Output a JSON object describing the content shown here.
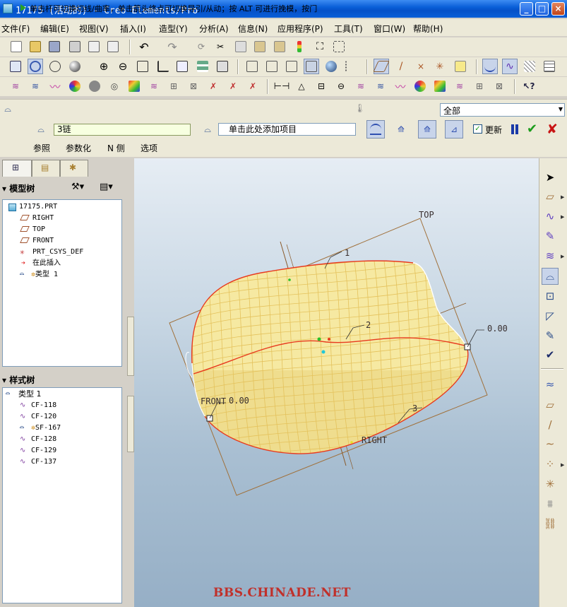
{
  "window": {
    "title": "17175 (活动的) - Creo Elements/Pro",
    "min_label": "_",
    "max_label": "□",
    "close_label": "×"
  },
  "menu": [
    "文件(F)",
    "编辑(E)",
    "视图(V)",
    "插入(I)",
    "造型(Y)",
    "分析(A)",
    "信息(N)",
    "应用程序(P)",
    "工具(T)",
    "窗口(W)",
    "帮助(H)"
  ],
  "toolbar_icons": {
    "row1": [
      "new-icon",
      "open-icon",
      "save-icon",
      "print-icon",
      "email-icon",
      "email-link-icon",
      "undo-icon",
      "redo-icon",
      "regenerate-icon",
      "cut-icon",
      "copy-icon",
      "paste-icon",
      "paste-special-icon",
      "traffic-light-icon",
      "find-icon",
      "select-box-icon"
    ],
    "row2": [
      "repaint-icon",
      "spin-center-icon",
      "orient-mode-icon",
      "appearance-icon",
      "zoom-in-icon",
      "zoom-out-icon",
      "refit-icon",
      "reorient-icon",
      "saved-views-icon",
      "layers-icon",
      "view-manager-icon",
      "wireframe-icon",
      "hidden-line-icon",
      "no-hidden-icon",
      "shading-icon",
      "enhanced-realism-icon",
      "model-tree-display-icon",
      "datum-plane-display-icon",
      "datum-axis-display-icon",
      "datum-point-display-icon",
      "csys-display-icon",
      "style-display-icon",
      "curve-display-icon",
      "surface-grid-icon",
      "grid-icon"
    ],
    "row3": [
      "curvature-icon",
      "section-icon",
      "offset-icon",
      "reflection-icon",
      "shade-curvature-icon",
      "draft-icon",
      "slope-icon",
      "dihedral-icon",
      "surface-node-icon",
      "deviation-icon",
      "delete-curvature-icon",
      "delete-section-icon",
      "delete-all-icon",
      "delete-analysis-icon",
      "measure-icon",
      "dimension-icon",
      "table-icon",
      "lock-icon",
      "curve-analysis-icon",
      "surface-analysis-icon",
      "connect-icon",
      "color-analysis-icon",
      "draft-analysis-icon",
      "graph-icon",
      "node-icon",
      "compare-icon",
      "context-help-icon"
    ]
  },
  "dashboard": {
    "prompt": "单击杆可切换切线/曲率，单击箭头终点可切换导引/从动；按 ALT 可进行挽模，按门",
    "filter": "全部",
    "chain_value": "3链",
    "add_item_placeholder": "单击此处添加项目",
    "update_label": "更新",
    "update_checked": true,
    "tabs": [
      "参照",
      "参数化",
      "N 侧",
      "选项"
    ]
  },
  "model_tree": {
    "header": "模型树",
    "items": [
      {
        "label": "17175.PRT",
        "icon": "part-icon"
      },
      {
        "label": "RIGHT",
        "icon": "datum-plane-icon"
      },
      {
        "label": "TOP",
        "icon": "datum-plane-icon"
      },
      {
        "label": "FRONT",
        "icon": "datum-plane-icon"
      },
      {
        "label": "PRT_CSYS_DEF",
        "icon": "csys-icon"
      },
      {
        "label": "在此插入",
        "icon": "insert-here-icon"
      },
      {
        "label": "类型 1",
        "icon": "style-feature-icon"
      }
    ]
  },
  "style_tree": {
    "header": "样式树",
    "items": [
      {
        "label": "类型 1",
        "icon": "style-feature-icon"
      },
      {
        "label": "CF-118",
        "icon": "curve-icon"
      },
      {
        "label": "CF-120",
        "icon": "curve-icon"
      },
      {
        "label": "SF-167",
        "icon": "surface-icon"
      },
      {
        "label": "CF-128",
        "icon": "curve-icon"
      },
      {
        "label": "CF-129",
        "icon": "curve-icon"
      },
      {
        "label": "CF-137",
        "icon": "curve-icon"
      }
    ]
  },
  "graphics": {
    "plane_labels": {
      "top": "TOP",
      "front": "FRONT",
      "right": "RIGHT"
    },
    "curve_labels": [
      "1",
      "2",
      "3"
    ],
    "tangent_values": {
      "left": "0.00",
      "right": "0.00"
    },
    "watermark": "BBS.CHINADE.NET",
    "colors": {
      "surface": "#f6e9a2",
      "grid": "#e4c25c",
      "boundary": "#e83a1e",
      "plane": "#a0703a",
      "background": "#a9bfd2"
    }
  },
  "right_toolbar": [
    "select-arrow-icon",
    "set-active-plane-icon",
    "create-curve-icon",
    "edit-curve-icon",
    "curve-from-surface-icon",
    "create-surface-icon",
    "connect-surface-icon",
    "trim-surface-icon",
    "edit-surface-icon",
    "done-icon",
    "curve-on-surface-icon",
    "internal-plane-icon",
    "circle-icon",
    "arc-icon",
    "point-icon",
    "intersection-icon",
    "tolerance-icon",
    "link-icon"
  ]
}
